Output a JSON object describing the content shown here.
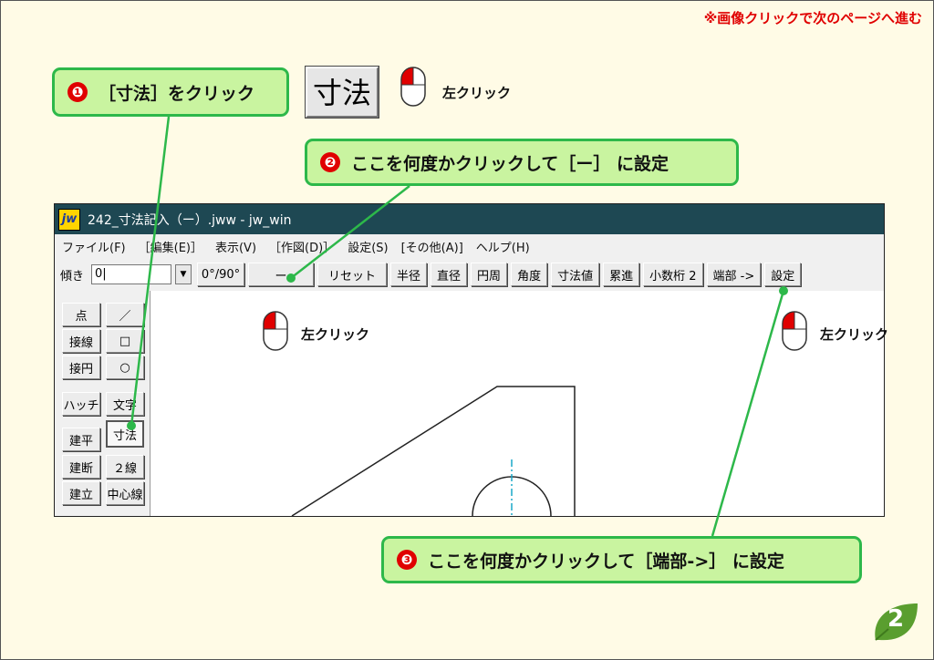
{
  "top_note": "※画像クリックで次のページへ進む",
  "callouts": [
    {
      "num": "❶",
      "text": "［寸法］をクリック"
    },
    {
      "num": "❷",
      "text": "ここを何度かクリックして［ー］ に設定"
    },
    {
      "num": "❸",
      "text": "ここを何度かクリックして［端部->］ に設定"
    }
  ],
  "big_button_label": "寸法",
  "left_click_label": "左クリック",
  "window": {
    "title": "242_寸法記入（ー）.jww - jw_win",
    "app_icon": "jw",
    "menu": [
      "ファイル(F)",
      "［編集(E)］",
      "表示(V)",
      "［作図(D)］",
      "設定(S)",
      "[その他(A)]",
      "ヘルプ(H)"
    ],
    "toolbar": {
      "tilt_label": "傾き",
      "tilt_value": "0|",
      "angle_btn": "0°/90°",
      "dash_btn": "ー",
      "buttons": [
        "リセット",
        "半径",
        "直径",
        "円周",
        "角度",
        "寸法値",
        "累進"
      ],
      "decimals_btn": "小数桁 2",
      "end_btn": "端部 ->",
      "settings_btn": "設定"
    },
    "palette_left": [
      "点",
      "接線",
      "接円",
      "ハッチ",
      "建平",
      "建断",
      "建立"
    ],
    "palette_right": [
      "／",
      "□",
      "○",
      "文字",
      "寸法",
      "２線",
      "中心線"
    ]
  },
  "page_number": "2",
  "colors": {
    "accent_red": "#e00000",
    "callout_green": "#2db84a",
    "callout_fill": "#c9f4a0",
    "titlebar": "#1e4853"
  }
}
